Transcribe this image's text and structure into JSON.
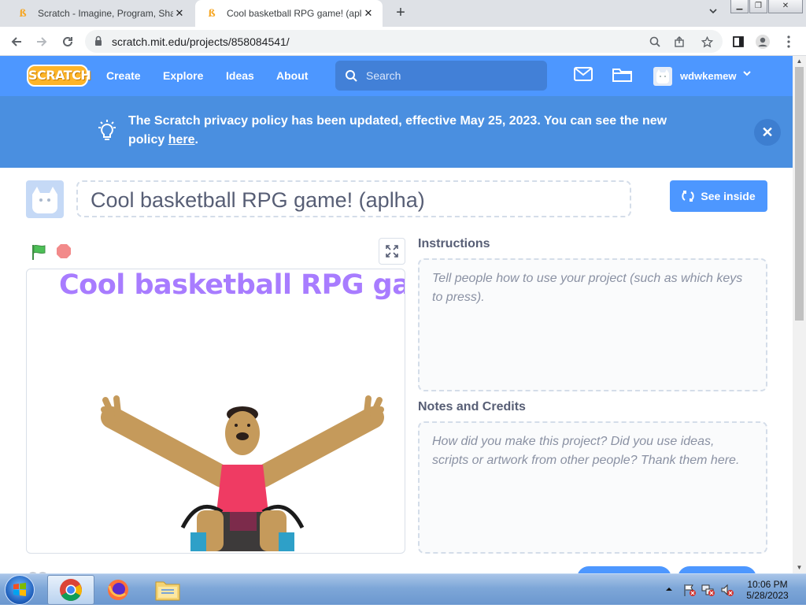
{
  "browser": {
    "tabs": [
      {
        "title": "Scratch - Imagine, Program, Shar",
        "active": false
      },
      {
        "title": "Cool basketball RPG game! (aplha",
        "active": true
      }
    ],
    "new_tab": "+",
    "tab_close": "✕",
    "url": "scratch.mit.edu/projects/858084541/"
  },
  "nav": {
    "logo": "SCRATCH",
    "links": [
      "Create",
      "Explore",
      "Ideas",
      "About"
    ],
    "search_placeholder": "Search",
    "username": "wdwkemew"
  },
  "banner": {
    "text": "The Scratch privacy policy has been updated, effective May 25, 2023. You can see the new policy ",
    "link": "here",
    "suffix": ".",
    "close": "✕"
  },
  "project": {
    "title": "Cool basketball RPG game! (aplha)",
    "see_inside": "See inside",
    "stage_title": "Cool basketball RPG game!"
  },
  "instructions": {
    "label": "Instructions",
    "placeholder": "Tell people how to use your project (such as which keys to press)."
  },
  "notes": {
    "label": "Notes and Credits",
    "placeholder": "How did you make this project? Did you use ideas, scripts or artwork from other people? Thank them here."
  },
  "taskbar": {
    "time": "10:06 PM",
    "date": "5/28/2023"
  },
  "colors": {
    "scratch_blue": "#4d97ff",
    "banner_blue": "#4a8fe0",
    "stage_title": "#9966ff",
    "flag_green": "#4cbf56",
    "stop_red": "#ec5959"
  }
}
